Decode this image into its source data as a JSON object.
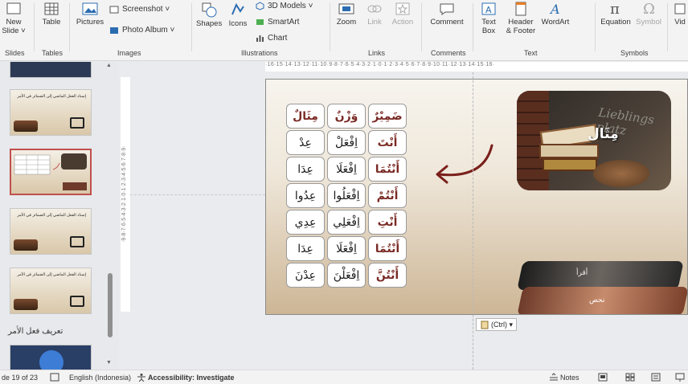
{
  "ribbon": {
    "buttons": {
      "new_slide": "New\nSlide ˅",
      "table": "Table",
      "pictures": "Pictures",
      "screenshot": "Screenshot ˅",
      "photo_album": "Photo Album ˅",
      "shapes": "Shapes",
      "icons": "Icons",
      "models3d": "3D Models ˅",
      "smartart": "SmartArt",
      "chart": "Chart",
      "zoom": "Zoom",
      "link": "Link",
      "action": "Action",
      "comment": "Comment",
      "text_box": "Text\nBox",
      "header_footer": "Header\n& Footer",
      "wordart": "WordArt",
      "equation": "Equation",
      "symbol": "Symbol",
      "video": "Vid"
    },
    "groups": {
      "slides": "Slides",
      "tables": "Tables",
      "images": "Images",
      "illustrations": "Illustrations",
      "links": "Links",
      "comments": "Comments",
      "text": "Text",
      "symbols": "Symbols"
    }
  },
  "slides_panel": {
    "thumb_title": "إسناد الفعل الماضي إلى الضمائر في الأمر",
    "section_heading": "تعريف فعل الأمر"
  },
  "rulers": {
    "horizontal": "·16·15·14·13·12·11·10·9·8·7·6·5·4·3·2·1·0·1·2·3·4·5·6·7·8·9·10·11·12·13·14·15·16·",
    "vertical": "·9·8·7·6·5·4·3·2·1·0·1·2·3·4·5·6·7·8·9·"
  },
  "slide": {
    "table_headers": [
      "ضَمِيْرٌ",
      "وَزْنٌ",
      "مِثَالٌ"
    ],
    "table_rows": [
      [
        "أَنْتَ",
        "اِفْعَلْ",
        "عِدْ"
      ],
      [
        "أَنْتُمَا",
        "اِفْعَلَا",
        "عِدَا"
      ],
      [
        "أَنْتُمْ",
        "اِفْعَلُوا",
        "عِدُوا"
      ],
      [
        "أَنْتِ",
        "اِفْعَلِي",
        "عِدِي"
      ],
      [
        "أَنْتُمَا",
        "اِفْعَلَا",
        "عِدَا"
      ],
      [
        "أَنْتُنَّ",
        "اِفْعَلْنَ",
        "عِدْنَ"
      ]
    ],
    "photo_caption": "مِثَال",
    "photo_board_text": "Lieblings platz",
    "book_label_1": "أقرأ",
    "book_label_2": "نحص"
  },
  "paste_options": "(Ctrl) ▾",
  "statusbar": {
    "slide_count": "de 19 of 23",
    "language": "English (Indonesia)",
    "accessibility": "Accessibility: Investigate",
    "notes": "Notes"
  },
  "colors": {
    "accent": "#c0504d",
    "arabic_heading": "#7a2a25"
  }
}
